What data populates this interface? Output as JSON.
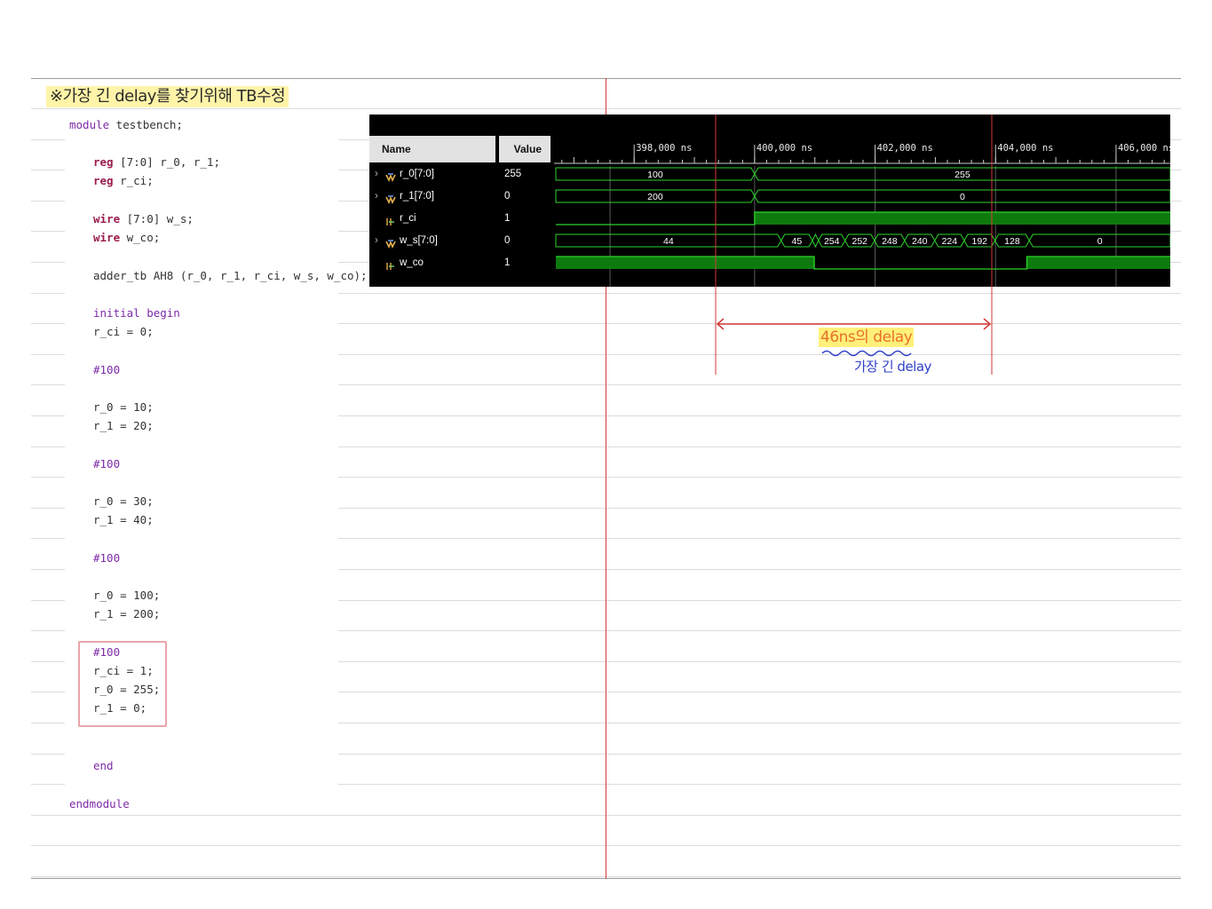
{
  "heading": "※가장 긴 delay를 찾기위해 TB수정",
  "code_lines": [
    {
      "parts": [
        {
          "t": "module",
          "c": "kw2"
        },
        {
          "t": " testbench;",
          "c": ""
        }
      ]
    },
    {
      "parts": [
        {
          "t": "reg",
          "c": "kw"
        },
        {
          "t": " [7:0] r_0, r_1;",
          "c": ""
        }
      ]
    },
    {
      "parts": [
        {
          "t": "reg",
          "c": "kw"
        },
        {
          "t": " r_ci;",
          "c": ""
        }
      ]
    },
    {
      "parts": [
        {
          "t": "wire",
          "c": "kw"
        },
        {
          "t": " [7:0] w_s;",
          "c": ""
        }
      ]
    },
    {
      "parts": [
        {
          "t": "wire",
          "c": "kw"
        },
        {
          "t": " w_co;",
          "c": ""
        }
      ]
    },
    {
      "parts": [
        {
          "t": "adder_tb AH8 (r_0, r_1, r_ci, w_s, w_co);",
          "c": ""
        }
      ]
    },
    {
      "parts": [
        {
          "t": "initial begin",
          "c": "kw2"
        }
      ]
    },
    {
      "parts": [
        {
          "t": "r_ci = 0;",
          "c": ""
        }
      ]
    },
    {
      "parts": [
        {
          "t": "#100",
          "c": "kw2"
        }
      ]
    },
    {
      "parts": [
        {
          "t": "r_0 = 10;",
          "c": ""
        }
      ]
    },
    {
      "parts": [
        {
          "t": "r_1 = 20;",
          "c": ""
        }
      ]
    },
    {
      "parts": [
        {
          "t": "#100",
          "c": "kw2"
        }
      ]
    },
    {
      "parts": [
        {
          "t": "r_0 = 30;",
          "c": ""
        }
      ]
    },
    {
      "parts": [
        {
          "t": "r_1 = 40;",
          "c": ""
        }
      ]
    },
    {
      "parts": [
        {
          "t": "#100",
          "c": "kw2"
        }
      ]
    },
    {
      "parts": [
        {
          "t": "r_0 = 100;",
          "c": ""
        }
      ]
    },
    {
      "parts": [
        {
          "t": "r_1 = 200;",
          "c": ""
        }
      ]
    },
    {
      "parts": [
        {
          "t": "#100",
          "c": "kw2"
        }
      ]
    },
    {
      "parts": [
        {
          "t": "r_ci = 1;",
          "c": ""
        }
      ]
    },
    {
      "parts": [
        {
          "t": "r_0 = 255;",
          "c": ""
        }
      ]
    },
    {
      "parts": [
        {
          "t": "r_1 = 0;",
          "c": ""
        }
      ]
    },
    {
      "parts": [
        {
          "t": "end",
          "c": "kw2"
        }
      ]
    },
    {
      "parts": [
        {
          "t": "endmodule",
          "c": "kw2"
        }
      ]
    }
  ],
  "waveform": {
    "headers": {
      "name": "Name",
      "value": "Value"
    },
    "time_unit": "ns",
    "view_start": 396700,
    "view_end": 406900,
    "time_labels": [
      "398,000 ns",
      "400,000 ns",
      "402,000 ns",
      "404,000 ns",
      "406,000 ns"
    ],
    "time_label_values": [
      398000,
      400000,
      402000,
      404000,
      406000
    ],
    "signals": [
      {
        "name": "r_0[7:0]",
        "value": "255",
        "kind": "bus",
        "icon": "bus-icon",
        "expandable": true,
        "segments": [
          {
            "from": 396700,
            "to": 400000,
            "label": "100"
          },
          {
            "from": 400000,
            "to": 406900,
            "label": "255"
          }
        ]
      },
      {
        "name": "r_1[7:0]",
        "value": "0",
        "kind": "bus",
        "icon": "bus-icon",
        "expandable": true,
        "segments": [
          {
            "from": 396700,
            "to": 400000,
            "label": "200"
          },
          {
            "from": 400000,
            "to": 406900,
            "label": "0"
          }
        ]
      },
      {
        "name": "r_ci",
        "value": "1",
        "kind": "bit",
        "icon": "bit-icon",
        "expandable": false,
        "transitions": [
          {
            "t": 396700,
            "v": 0
          },
          {
            "t": 400000,
            "v": 1
          }
        ]
      },
      {
        "name": "w_s[7:0]",
        "value": "0",
        "kind": "bus",
        "icon": "bus-icon",
        "expandable": true,
        "segments": [
          {
            "from": 396700,
            "to": 400440,
            "label": "44"
          },
          {
            "from": 400440,
            "to": 400960,
            "label": "45"
          },
          {
            "from": 400960,
            "to": 401060,
            "label": ""
          },
          {
            "from": 401060,
            "to": 401500,
            "label": "254"
          },
          {
            "from": 401500,
            "to": 401990,
            "label": "252"
          },
          {
            "from": 401990,
            "to": 402490,
            "label": "248"
          },
          {
            "from": 402490,
            "to": 402990,
            "label": "240"
          },
          {
            "from": 402990,
            "to": 403480,
            "label": "224"
          },
          {
            "from": 403480,
            "to": 403990,
            "label": "192"
          },
          {
            "from": 403990,
            "to": 404560,
            "label": "128"
          },
          {
            "from": 404560,
            "to": 406900,
            "label": "0"
          }
        ]
      },
      {
        "name": "w_co",
        "value": "1",
        "kind": "bit",
        "icon": "bit-icon",
        "expandable": false,
        "transitions": [
          {
            "t": 396700,
            "v": 1
          },
          {
            "t": 400990,
            "v": 0
          },
          {
            "t": 404520,
            "v": 1
          }
        ]
      }
    ],
    "grid_times": [
      397600,
      400000,
      402000,
      404000,
      406000
    ],
    "cursor_times": [
      400000,
      404600
    ]
  },
  "annotations": {
    "delay_note": "46ns의 delay",
    "longest_note": "가장 긴 delay"
  },
  "colors": {
    "wave": "#2bd42b",
    "wave_fill": "#0e7a0e",
    "cursor": "#d23a3a",
    "margin": "#d23a3a",
    "keyword": "#9b1c4c",
    "keyword2": "#7d2aa6"
  }
}
